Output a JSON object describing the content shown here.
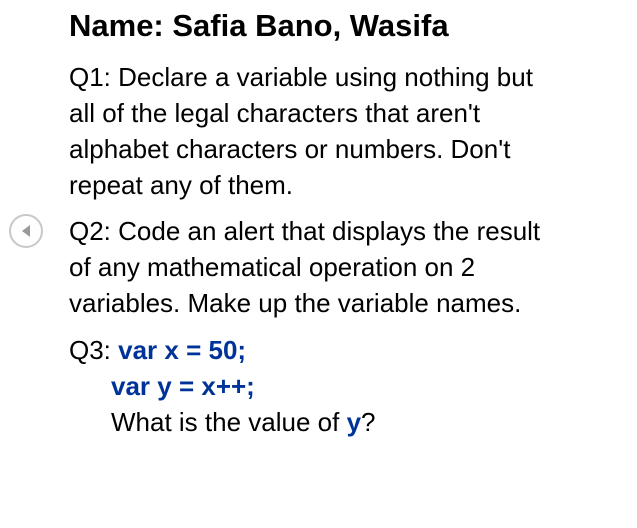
{
  "slide": {
    "title": "Name: Safia Bano, Wasifa",
    "q1": {
      "lines": [
        "Q1: Declare a variable using nothing but",
        "all of the legal characters that aren't",
        "alphabet characters or numbers. Don't",
        "repeat any of them."
      ]
    },
    "q2": {
      "lines": [
        "Q2: Code an alert that displays the result",
        "of any mathematical operation on 2",
        "variables. Make up the variable names."
      ]
    },
    "q3": {
      "prefix": "Q3: ",
      "code_line1": "var x = 50;",
      "code_line2": "var y = x++;",
      "question_before": "What is the value of ",
      "question_var": "y",
      "question_after": "?"
    }
  },
  "nav": {
    "prev_icon": "chevron-left-icon"
  },
  "colors": {
    "code": "#003399",
    "nav_border": "#c8c8c8"
  }
}
